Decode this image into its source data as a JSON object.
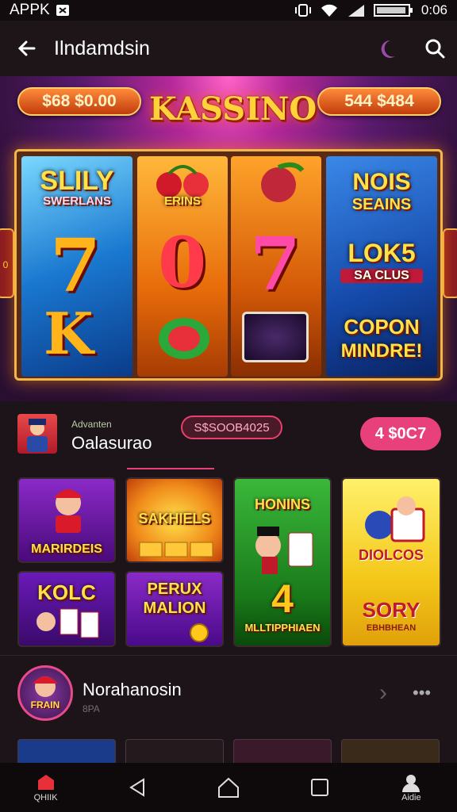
{
  "status_bar": {
    "app_label": "APPK",
    "time": "0:06",
    "battery_text": "▯▯▯▯"
  },
  "app_bar": {
    "title": "Ilndamdsin"
  },
  "banner": {
    "left_pill": "$68 $0.00",
    "right_pill": "544 $484",
    "logo": "KASSINO",
    "reel1": {
      "top": "SLILY",
      "top_sub": "SWERLANS",
      "mid": "7",
      "bottom": "K"
    },
    "reel2": {
      "top": "ERINS",
      "mid": "0"
    },
    "reel3": {
      "mid": "7"
    },
    "reel4": {
      "top": "NOIS",
      "top_sub": "SEAINS",
      "mid": "LOK5",
      "mid_sub": "SA CLUS",
      "bottom": "COPON",
      "bottom_sub": "MINDRE!"
    },
    "side_left": "0"
  },
  "profile": {
    "tiny_label": "Advanten",
    "name": "Oalasurao",
    "code": "S$SOOB4025",
    "price": "4 $0C7"
  },
  "games": [
    {
      "label": "MARIRDEIS"
    },
    {
      "label": "SAKHIELS"
    },
    {
      "label_top": "HONINS",
      "label_big": "4",
      "label": "MLLTIPPHIAEN"
    },
    {
      "label": "DIOLCOS",
      "label2": "SORY",
      "label3": "EBHBHEAN"
    },
    {
      "label": "KOLC"
    },
    {
      "label": "PERUX",
      "label2": "MALION"
    }
  ],
  "featured": {
    "name": "Norahanosin",
    "sub": "8PA",
    "badge": "FRAIN"
  },
  "nav": {
    "left_label": "QHIIK",
    "right_label": "Aidie"
  },
  "colors": {
    "accent": "#e8407a",
    "gold": "#ffd23a"
  }
}
